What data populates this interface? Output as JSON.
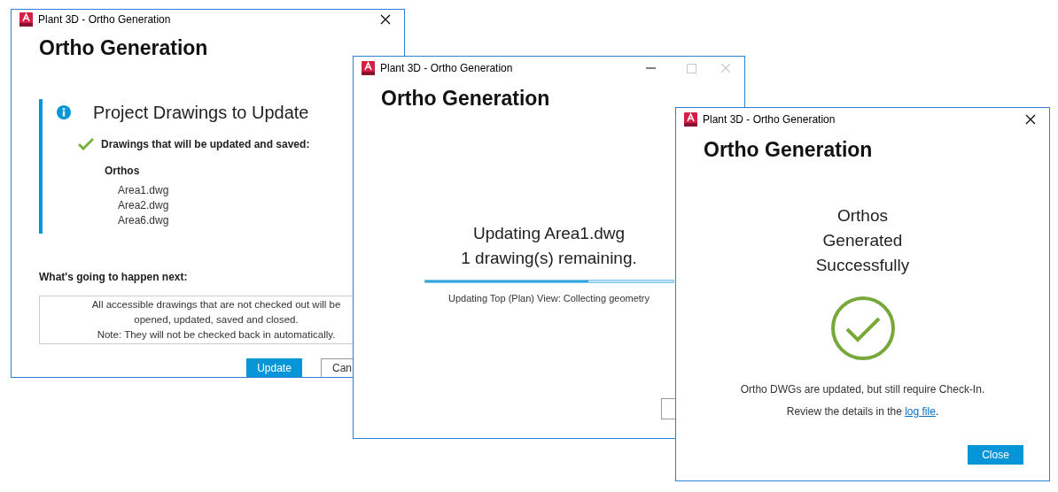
{
  "windows": [
    {
      "kind": "review",
      "title": "Plant 3D - Ortho Generation",
      "controls": [
        {
          "kind": "close",
          "disabled": false
        }
      ],
      "heading": "Ortho Generation",
      "section_title": "Project Drawings to Update",
      "check_label": "Drawings that will be updated and saved:",
      "group": "Orthos",
      "files": [
        "Area1.dwg",
        "Area2.dwg",
        "Area6.dwg"
      ],
      "next_label": "What's going to happen next:",
      "info_lines": [
        "All accessible drawings that are not checked out will be",
        "opened, updated, saved and closed.",
        "Note: They will not be checked back in automatically."
      ],
      "buttons": [
        {
          "label": "Update",
          "primary": true
        },
        {
          "label": "Can",
          "primary": false
        }
      ]
    },
    {
      "kind": "progress",
      "title": "Plant 3D - Ortho Generation",
      "controls": [
        {
          "kind": "minimize",
          "disabled": false
        },
        {
          "kind": "maximize",
          "disabled": true
        },
        {
          "kind": "close",
          "disabled": true
        }
      ],
      "heading": "Ortho Generation",
      "status_lines": [
        "Updating Area1.dwg",
        "1 drawing(s) remaining."
      ],
      "level": 0.66,
      "detail": "Updating Top (Plan) View: Collecting geometry"
    },
    {
      "kind": "done",
      "title": "Plant 3D - Ortho Generation",
      "controls": [
        {
          "kind": "close",
          "disabled": false
        }
      ],
      "heading": "Ortho Generation",
      "result_lines": [
        "Orthos",
        "Generated",
        "Successfully"
      ],
      "message": "Ortho DWGs are updated, but still require Check-In.",
      "review_text": "Review the details in the",
      "link": "log file",
      "review_end": ".",
      "buttons": [
        {
          "label": "Close",
          "primary": true
        }
      ]
    }
  ]
}
